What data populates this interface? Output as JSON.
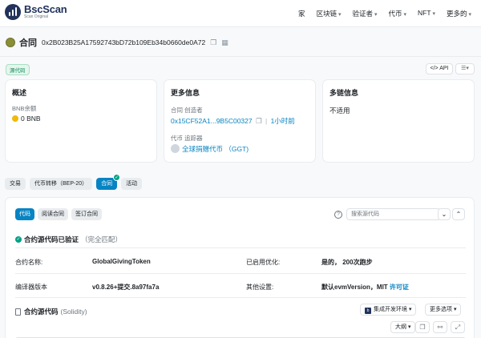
{
  "brand": {
    "name": "BscScan",
    "sub": "Scan Original"
  },
  "nav": [
    {
      "label": "家",
      "dropdown": false
    },
    {
      "label": "区块链",
      "dropdown": true
    },
    {
      "label": "验证者",
      "dropdown": true
    },
    {
      "label": "代币",
      "dropdown": true
    },
    {
      "label": "NFT",
      "dropdown": true
    },
    {
      "label": "更多的",
      "dropdown": true
    }
  ],
  "page": {
    "title": "合同",
    "address": "0x2B023B25A17592743bD72b109Eb34b0660de0A72",
    "source_badge": "源代码",
    "api_label": "</> API"
  },
  "overview": {
    "title": "概述",
    "balance_label": "BNB余额",
    "balance_value": "0 BNB"
  },
  "more_info": {
    "title": "更多信息",
    "creator_label": "合同 创造者",
    "creator_address": "0x15CF52A1...9B5C00327",
    "creator_time": "1小时前",
    "tracker_label": "代币 追踪器",
    "tracker_value": "全球捐赠代币 （GGT)"
  },
  "multichain": {
    "title": "多链信息",
    "value": "不适用"
  },
  "tabs": [
    "交易",
    "代币转移（BEP-20）",
    "合同",
    "活动"
  ],
  "active_tab": 2,
  "subtabs": [
    "代码",
    "阅读合同",
    "签订合同"
  ],
  "active_subtab": 0,
  "search_placeholder": "搜索源代码",
  "verified": {
    "label": "合约源代码已验证",
    "note": "（完全匹配）"
  },
  "details": {
    "name_label": "合约名称:",
    "name_value": "GlobalGivingToken",
    "opt_label": "已启用优化:",
    "opt_value": "是的， 200次跑步",
    "compiler_label": "编译器版本",
    "compiler_value": "v0.8.26+提交.8a97fa7a",
    "other_label": "其他设置:",
    "other_value": "默认evmVersion，MIT",
    "license": "许可证"
  },
  "source": {
    "title": "合约源代码",
    "lang": "(Solidity)",
    "ide_btn": "集成开发环境",
    "more_btn": "更多选项",
    "outline_btn": "大纲"
  }
}
